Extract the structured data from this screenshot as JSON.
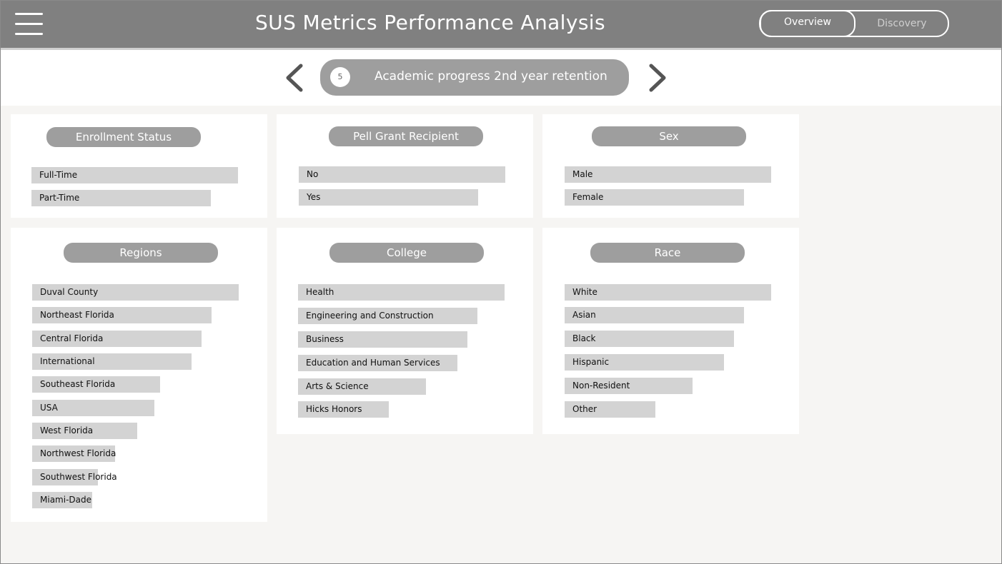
{
  "header": {
    "title": "SUS Metrics Performance Analysis",
    "tabs": [
      {
        "label": "Overview",
        "active": true
      },
      {
        "label": "Discovery",
        "active": false
      }
    ]
  },
  "metric_nav": {
    "number": "5",
    "label": "Academic progress 2nd year retention"
  },
  "colors": {
    "header_bg": "#808080",
    "pill_bg": "#9e9e9e",
    "bar_bg": "#d3d3d3",
    "page_bg": "#f6f5f3"
  },
  "cards": {
    "enrollment": {
      "title": "Enrollment Status",
      "items": [
        {
          "label": "Full-Time",
          "level": 1.0
        },
        {
          "label": "Part-Time",
          "level": 0.87
        }
      ]
    },
    "pell": {
      "title": "Pell Grant Recipient",
      "items": [
        {
          "label": "No",
          "level": 1.0
        },
        {
          "label": "Yes",
          "level": 0.87
        }
      ]
    },
    "sex": {
      "title": "Sex",
      "items": [
        {
          "label": "Male",
          "level": 1.0
        },
        {
          "label": "Female",
          "level": 0.87
        }
      ]
    },
    "regions": {
      "title": "Regions",
      "items": [
        {
          "label": "Duval County",
          "level": 1.0
        },
        {
          "label": "Northeast Florida",
          "level": 0.87
        },
        {
          "label": "Central Florida",
          "level": 0.82
        },
        {
          "label": "International",
          "level": 0.77
        },
        {
          "label": "Southeast Florida",
          "level": 0.62
        },
        {
          "label": "USA",
          "level": 0.59
        },
        {
          "label": "West Florida",
          "level": 0.51
        },
        {
          "label": "Northwest Florida",
          "level": 0.4
        },
        {
          "label": "Southwest Florida",
          "level": 0.32
        },
        {
          "label": "Miami-Dade",
          "level": 0.29
        }
      ]
    },
    "college": {
      "title": "College",
      "items": [
        {
          "label": "Health",
          "level": 1.0
        },
        {
          "label": "Engineering and Construction",
          "level": 0.87
        },
        {
          "label": "Business",
          "level": 0.82
        },
        {
          "label": "Education and Human Services",
          "level": 0.77
        },
        {
          "label": "Arts & Science",
          "level": 0.62
        },
        {
          "label": "Hicks Honors",
          "level": 0.44
        }
      ]
    },
    "race": {
      "title": "Race",
      "items": [
        {
          "label": "White",
          "level": 1.0
        },
        {
          "label": "Asian",
          "level": 0.87
        },
        {
          "label": "Black",
          "level": 0.82
        },
        {
          "label": "Hispanic",
          "level": 0.77
        },
        {
          "label": "Non-Resident",
          "level": 0.62
        },
        {
          "label": "Other",
          "level": 0.44
        }
      ]
    }
  }
}
